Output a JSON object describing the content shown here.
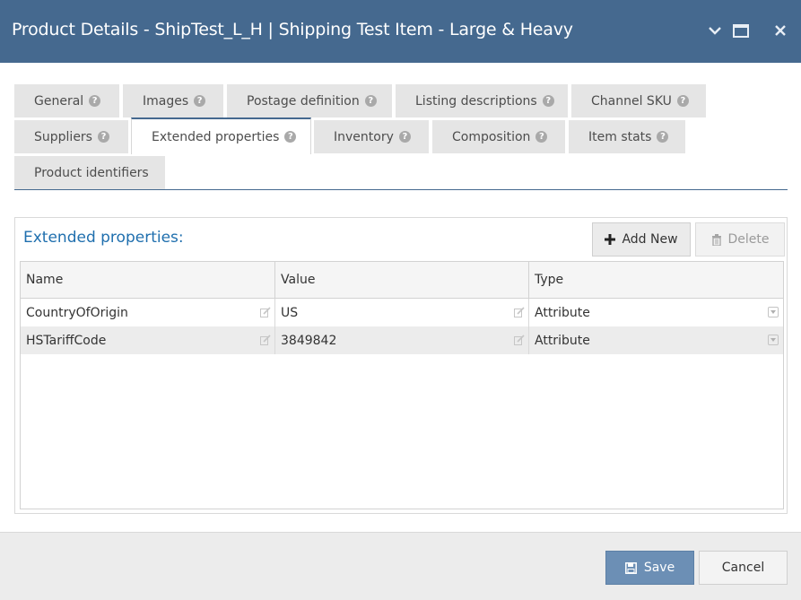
{
  "window": {
    "title": "Product Details - ShipTest_L_H | Shipping Test Item - Large & Heavy"
  },
  "tabs": [
    {
      "label": "General",
      "help": true
    },
    {
      "label": "Images",
      "help": true
    },
    {
      "label": "Postage definition",
      "help": true
    },
    {
      "label": "Listing descriptions",
      "help": true
    },
    {
      "label": "Channel SKU",
      "help": true
    },
    {
      "label": "Suppliers",
      "help": true
    },
    {
      "label": "Extended properties",
      "help": true,
      "active": true
    },
    {
      "label": "Inventory",
      "help": true
    },
    {
      "label": "Composition",
      "help": true
    },
    {
      "label": "Item stats",
      "help": true
    },
    {
      "label": "Product identifiers",
      "help": false
    }
  ],
  "panel": {
    "title": "Extended properties:",
    "add_label": "Add New",
    "delete_label": "Delete"
  },
  "grid": {
    "columns": [
      "Name",
      "Value",
      "Type"
    ],
    "rows": [
      {
        "name": "CountryOfOrigin",
        "value": "US",
        "type": "Attribute"
      },
      {
        "name": "HSTariffCode",
        "value": "3849842",
        "type": "Attribute"
      }
    ]
  },
  "footer": {
    "save_label": "Save",
    "cancel_label": "Cancel"
  },
  "colors": {
    "titlebar": "#45698f",
    "accent_text": "#1f6fae",
    "save_button": "#6c8fb5"
  }
}
